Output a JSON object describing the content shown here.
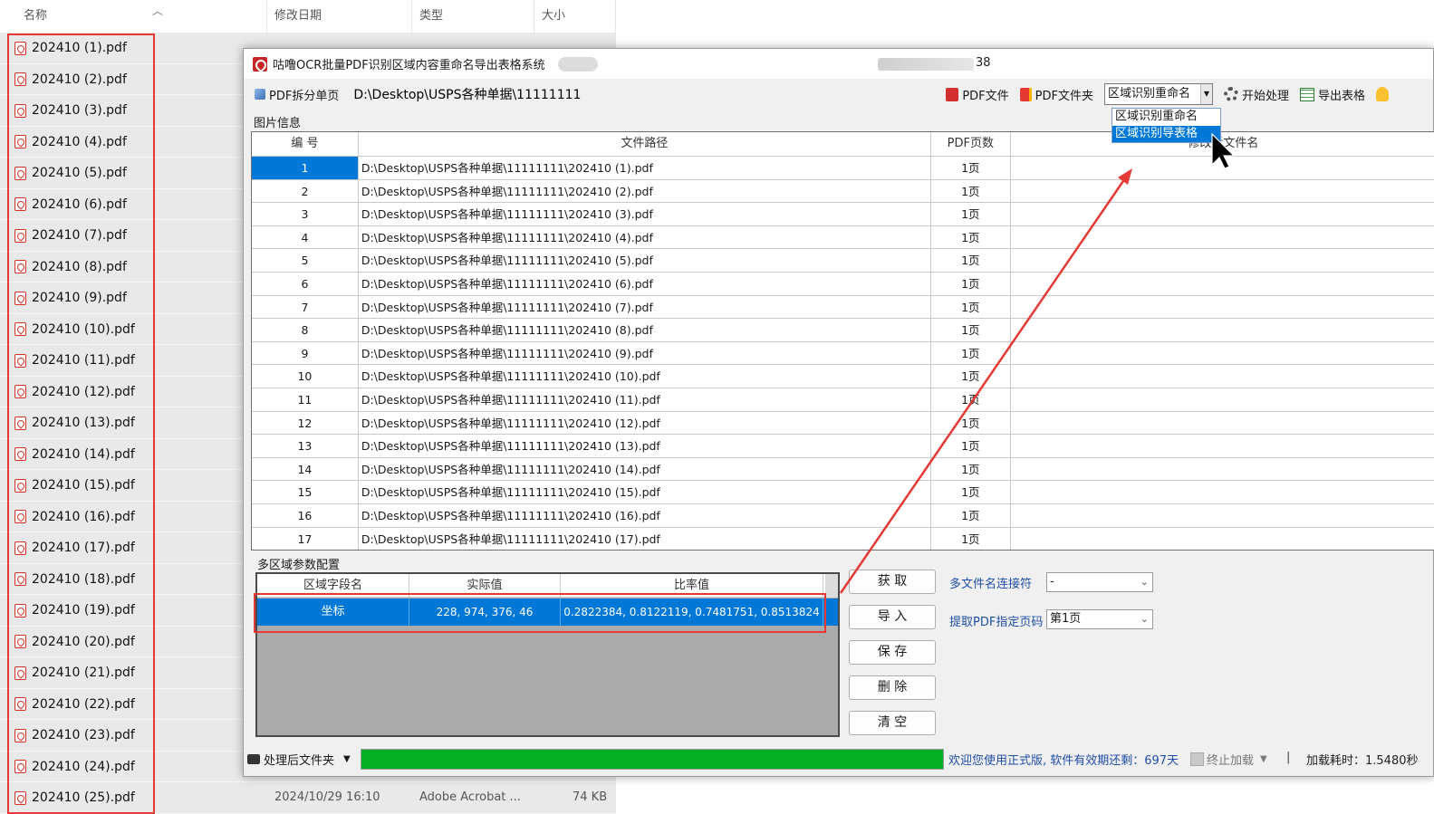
{
  "explorer": {
    "columns": {
      "name": "名称",
      "modified": "修改日期",
      "type": "类型",
      "size": "大小"
    },
    "files": [
      "202410 (1).pdf",
      "202410 (2).pdf",
      "202410 (3).pdf",
      "202410 (4).pdf",
      "202410 (5).pdf",
      "202410 (6).pdf",
      "202410 (7).pdf",
      "202410 (8).pdf",
      "202410 (9).pdf",
      "202410 (10).pdf",
      "202410 (11).pdf",
      "202410 (12).pdf",
      "202410 (13).pdf",
      "202410 (14).pdf",
      "202410 (15).pdf",
      "202410 (16).pdf",
      "202410 (17).pdf",
      "202410 (18).pdf",
      "202410 (19).pdf",
      "202410 (20).pdf",
      "202410 (21).pdf",
      "202410 (22).pdf",
      "202410 (23).pdf",
      "202410 (24).pdf",
      "202410 (25).pdf"
    ],
    "last_row": {
      "modified": "2024/10/29 16:10",
      "type": "Adobe Acrobat ...",
      "size": "74 KB"
    }
  },
  "app": {
    "title": "咕噜OCR批量PDF识别区域内容重命名导出表格系统",
    "title_suffix": "38",
    "toolbar": {
      "split_label": "PDF拆分单页",
      "path_value": "D:\\Desktop\\USPS各种单据\\11111111",
      "pdf_file_label": "PDF文件",
      "pdf_folder_label": "PDF文件夹",
      "mode_value": "区域识别重命名",
      "start_label": "开始处理",
      "export_label": "导出表格"
    },
    "mode_options": [
      "区域识别重命名",
      "区域识别导表格"
    ],
    "image_group_label": "图片信息",
    "grid_columns": {
      "num": "编 号",
      "path": "文件路径",
      "pages": "PDF页数",
      "new_name": "修改后文件名"
    },
    "grid_rows": [
      {
        "num": "1",
        "path": "D:\\Desktop\\USPS各种单据\\11111111\\202410 (1).pdf",
        "pages": "1页"
      },
      {
        "num": "2",
        "path": "D:\\Desktop\\USPS各种单据\\11111111\\202410 (2).pdf",
        "pages": "1页"
      },
      {
        "num": "3",
        "path": "D:\\Desktop\\USPS各种单据\\11111111\\202410 (3).pdf",
        "pages": "1页"
      },
      {
        "num": "4",
        "path": "D:\\Desktop\\USPS各种单据\\11111111\\202410 (4).pdf",
        "pages": "1页"
      },
      {
        "num": "5",
        "path": "D:\\Desktop\\USPS各种单据\\11111111\\202410 (5).pdf",
        "pages": "1页"
      },
      {
        "num": "6",
        "path": "D:\\Desktop\\USPS各种单据\\11111111\\202410 (6).pdf",
        "pages": "1页"
      },
      {
        "num": "7",
        "path": "D:\\Desktop\\USPS各种单据\\11111111\\202410 (7).pdf",
        "pages": "1页"
      },
      {
        "num": "8",
        "path": "D:\\Desktop\\USPS各种单据\\11111111\\202410 (8).pdf",
        "pages": "1页"
      },
      {
        "num": "9",
        "path": "D:\\Desktop\\USPS各种单据\\11111111\\202410 (9).pdf",
        "pages": "1页"
      },
      {
        "num": "10",
        "path": "D:\\Desktop\\USPS各种单据\\11111111\\202410 (10).pdf",
        "pages": "1页"
      },
      {
        "num": "11",
        "path": "D:\\Desktop\\USPS各种单据\\11111111\\202410 (11).pdf",
        "pages": "1页"
      },
      {
        "num": "12",
        "path": "D:\\Desktop\\USPS各种单据\\11111111\\202410 (12).pdf",
        "pages": "1页"
      },
      {
        "num": "13",
        "path": "D:\\Desktop\\USPS各种单据\\11111111\\202410 (13).pdf",
        "pages": "1页"
      },
      {
        "num": "14",
        "path": "D:\\Desktop\\USPS各种单据\\11111111\\202410 (14).pdf",
        "pages": "1页"
      },
      {
        "num": "15",
        "path": "D:\\Desktop\\USPS各种单据\\11111111\\202410 (15).pdf",
        "pages": "1页"
      },
      {
        "num": "16",
        "path": "D:\\Desktop\\USPS各种单据\\11111111\\202410 (16).pdf",
        "pages": "1页"
      },
      {
        "num": "17",
        "path": "D:\\Desktop\\USPS各种单据\\11111111\\202410 (17).pdf",
        "pages": "1页"
      }
    ],
    "region_group_label": "多区域参数配置",
    "region_columns": {
      "name": "区域字段名",
      "real": "实际值",
      "ratio": "比率值"
    },
    "region_rows": [
      {
        "name": "坐标",
        "real": "228, 974, 376, 46",
        "ratio": "0.2822384, 0.8122119, 0.7481751, 0.8513824"
      }
    ],
    "buttons": {
      "get": "获 取",
      "import": "导 入",
      "save": "保 存",
      "delete": "删 除",
      "clear": "清 空"
    },
    "options": {
      "joiner_label": "多文件名连接符",
      "joiner_value": "-",
      "page_label": "提取PDF指定页码",
      "page_value": "第1页"
    },
    "status": {
      "folder_label": "处理后文件夹",
      "progress": 1.0,
      "message": "欢迎您使用正式版, 软件有效期还剩：697天",
      "stop_label": "终止加载",
      "separator": "|",
      "time_label": "加载耗时：1.5480秒"
    },
    "colors": {
      "selection": "#0078d7",
      "progress": "#06b025",
      "highlight": "#e53935",
      "link": "#1f4ea8"
    }
  }
}
